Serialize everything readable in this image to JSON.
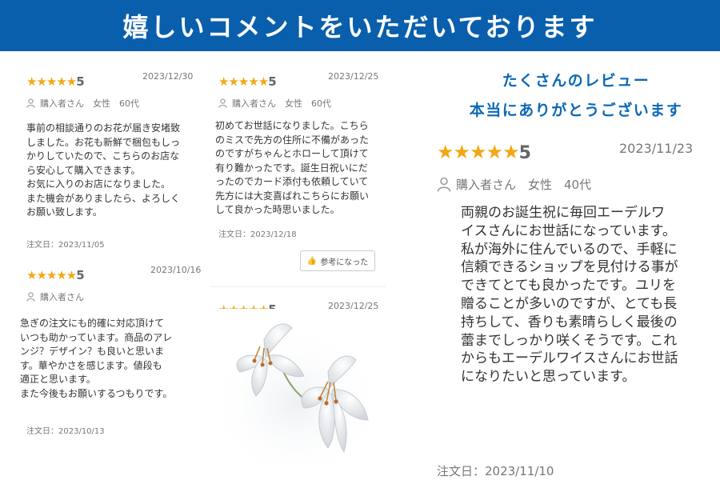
{
  "banner": {
    "title": "嬉しいコメントをいただいております"
  },
  "reviews": [
    {
      "stars": "★★★★★",
      "score": "5",
      "date": "2023/12/30",
      "user": "購入者さん　女性　60代",
      "text": "事前の相談通りのお花が届き安堵致\nしました。お花も新鮮で梱包もしっ\nかりしていたので、こちらのお店な\nら安心して購入できます。\nお気に入りのお店になりました。\nまた機会がありましたら、よろしく\nお願い致します。",
      "order": "注文日：2023/11/05"
    },
    {
      "stars": "★★★★★",
      "score": "5",
      "date": "2023/12/25",
      "user": "購入者さん　女性　60代",
      "text": "初めてお世話になりました。こちら\nのミスで先方の住所に不備があった\nのですがちゃんとホローして頂けて\n有り難かったです。誕生日祝いにだ\nったのでカード添付も依頼していて\n先方には大変喜ばれこちらにお願い\nして良かった時思いました。",
      "order": "注文日：2023/12/18",
      "helpful": "参考になった"
    },
    {
      "stars": "★★★★★",
      "score": "5",
      "date": "2023/10/16",
      "user": "購入者さん",
      "text": "急ぎの注文にも的確に対応頂けて\nいつも助かっています。商品のアレ\nンジ？デザイン？も良いと思いま\nす。華やかさを感じます。値段も\n適正と思います。\nまた今後もお願いするつもりです。",
      "order": "注文日：2023/10/13"
    },
    {
      "stars": "★★★★★",
      "score": "5",
      "date": "2023/12/25"
    }
  ],
  "thanks": {
    "line1": "たくさんのレビュー",
    "line2": "本当にありがとうございます"
  },
  "featured": {
    "stars": "★★★★★",
    "score": "5",
    "date": "2023/11/23",
    "user": "購入者さん　女性　40代",
    "text": "両親のお誕生祝に毎回エーデルワ\nイスさんにお世話になっています。\n私が海外に住んでいるので、手軽に\n信頼できるショップを見付ける事が\nできてとても良かったです。ユリを\n贈ることが多いのですが、とても長\n持ちして、香りも素晴らしく最後の\n蕾までしっかり咲くそうです。これ\nからもエーデルワイスさんにお世話\nになりたいと思っています。",
    "order": "注文日：2023/11/10"
  },
  "colors": {
    "banner": "#0a5fac",
    "stars": "#f2a814",
    "thanks": "#0b68b8"
  },
  "icons": [
    "user-icon",
    "thumbs-up-icon",
    "lily-image"
  ]
}
